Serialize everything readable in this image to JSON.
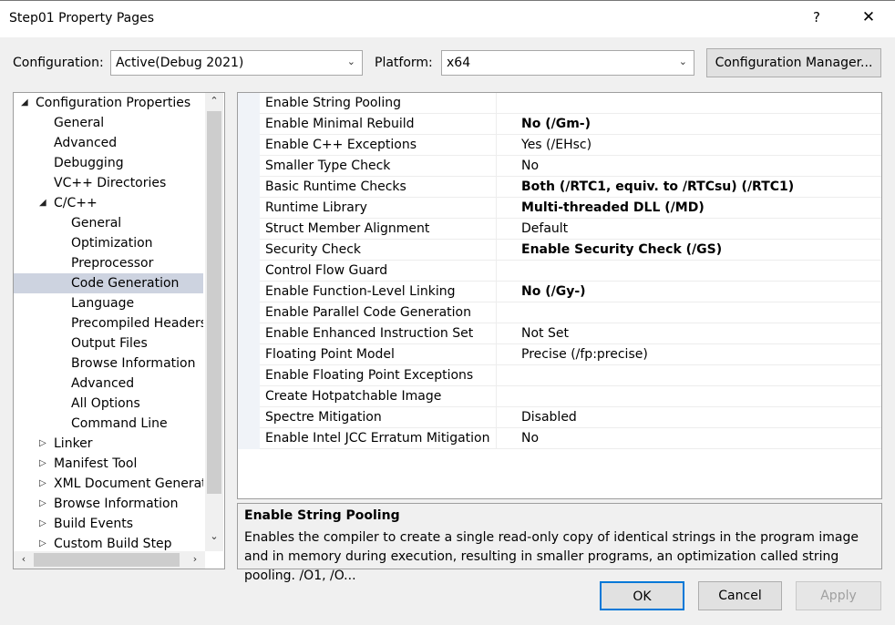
{
  "window": {
    "title": "Step01 Property Pages",
    "help": "?",
    "close": "✕"
  },
  "toolbar": {
    "configuration_label": "Configuration:",
    "configuration_value": "Active(Debug 2021)",
    "platform_label": "Platform:",
    "platform_value": "x64",
    "configuration_manager": "Configuration Manager..."
  },
  "tree": {
    "items": [
      {
        "label": "Configuration Properties",
        "level": 0,
        "expander": "◢"
      },
      {
        "label": "General",
        "level": 1
      },
      {
        "label": "Advanced",
        "level": 1
      },
      {
        "label": "Debugging",
        "level": 1
      },
      {
        "label": "VC++ Directories",
        "level": 1
      },
      {
        "label": "C/C++",
        "level": 1,
        "expander": "◢"
      },
      {
        "label": "General",
        "level": 2
      },
      {
        "label": "Optimization",
        "level": 2
      },
      {
        "label": "Preprocessor",
        "level": 2
      },
      {
        "label": "Code Generation",
        "level": 2,
        "selected": true
      },
      {
        "label": "Language",
        "level": 2
      },
      {
        "label": "Precompiled Headers",
        "level": 2
      },
      {
        "label": "Output Files",
        "level": 2
      },
      {
        "label": "Browse Information",
        "level": 2
      },
      {
        "label": "Advanced",
        "level": 2
      },
      {
        "label": "All Options",
        "level": 2
      },
      {
        "label": "Command Line",
        "level": 2
      },
      {
        "label": "Linker",
        "level": 1,
        "expander": "▷"
      },
      {
        "label": "Manifest Tool",
        "level": 1,
        "expander": "▷"
      },
      {
        "label": "XML Document Generatc",
        "level": 1,
        "expander": "▷"
      },
      {
        "label": "Browse Information",
        "level": 1,
        "expander": "▷"
      },
      {
        "label": "Build Events",
        "level": 1,
        "expander": "▷"
      },
      {
        "label": "Custom Build Step",
        "level": 1,
        "expander": "▷"
      }
    ]
  },
  "properties": [
    {
      "name": "Enable String Pooling",
      "value": "",
      "bold": false
    },
    {
      "name": "Enable Minimal Rebuild",
      "value": "No (/Gm-)",
      "bold": true
    },
    {
      "name": "Enable C++ Exceptions",
      "value": "Yes (/EHsc)",
      "bold": false
    },
    {
      "name": "Smaller Type Check",
      "value": "No",
      "bold": false
    },
    {
      "name": "Basic Runtime Checks",
      "value": "Both (/RTC1, equiv. to /RTCsu) (/RTC1)",
      "bold": true
    },
    {
      "name": "Runtime Library",
      "value": "Multi-threaded DLL (/MD)",
      "bold": true
    },
    {
      "name": "Struct Member Alignment",
      "value": "Default",
      "bold": false
    },
    {
      "name": "Security Check",
      "value": "Enable Security Check (/GS)",
      "bold": true
    },
    {
      "name": "Control Flow Guard",
      "value": "",
      "bold": false
    },
    {
      "name": "Enable Function-Level Linking",
      "value": "No (/Gy-)",
      "bold": true
    },
    {
      "name": "Enable Parallel Code Generation",
      "value": "",
      "bold": false
    },
    {
      "name": "Enable Enhanced Instruction Set",
      "value": "Not Set",
      "bold": false
    },
    {
      "name": "Floating Point Model",
      "value": "Precise (/fp:precise)",
      "bold": false
    },
    {
      "name": "Enable Floating Point Exceptions",
      "value": "",
      "bold": false
    },
    {
      "name": "Create Hotpatchable Image",
      "value": "",
      "bold": false
    },
    {
      "name": "Spectre Mitigation",
      "value": "Disabled",
      "bold": false
    },
    {
      "name": "Enable Intel JCC Erratum Mitigation",
      "value": "No",
      "bold": false
    }
  ],
  "description": {
    "title": "Enable String Pooling",
    "text": "Enables the compiler to create a single read-only copy of identical strings in the program image and in memory during execution, resulting in smaller programs, an optimization called string pooling. /O1, /O..."
  },
  "buttons": {
    "ok": "OK",
    "cancel": "Cancel",
    "apply": "Apply"
  },
  "icons": {
    "chevron_down": "chevron-down-icon",
    "scroll_up": "▲",
    "scroll_down": "▼"
  }
}
